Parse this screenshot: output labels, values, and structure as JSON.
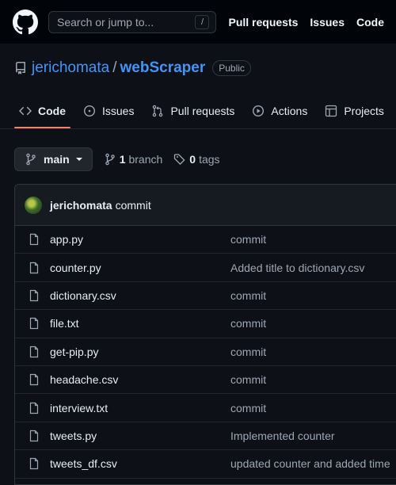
{
  "header": {
    "logo_icon": "github-mark-icon",
    "search_placeholder": "Search or jump to...",
    "search_shortcut": "/",
    "nav": [
      "Pull requests",
      "Issues",
      "Code"
    ]
  },
  "repo": {
    "owner": "jerichomata",
    "separator": "/",
    "name": "webScraper",
    "visibility": "Public"
  },
  "tabs": [
    {
      "label": "Code",
      "icon": "code-icon",
      "active": true
    },
    {
      "label": "Issues",
      "icon": "issue-icon",
      "active": false
    },
    {
      "label": "Pull requests",
      "icon": "pull-request-icon",
      "active": false
    },
    {
      "label": "Actions",
      "icon": "play-icon",
      "active": false
    },
    {
      "label": "Projects",
      "icon": "table-icon",
      "active": false
    }
  ],
  "branch": {
    "current": "main",
    "branch_count": "1",
    "branch_label": "branch",
    "tag_count": "0",
    "tag_label": "tags"
  },
  "latest_commit": {
    "author": "jerichomata",
    "message": "commit"
  },
  "files": [
    {
      "name": "app.py",
      "commit": "commit"
    },
    {
      "name": "counter.py",
      "commit": "Added title to dictionary.csv"
    },
    {
      "name": "dictionary.csv",
      "commit": "commit"
    },
    {
      "name": "file.txt",
      "commit": "commit"
    },
    {
      "name": "get-pip.py",
      "commit": "commit"
    },
    {
      "name": "headache.csv",
      "commit": "commit"
    },
    {
      "name": "interview.txt",
      "commit": "commit"
    },
    {
      "name": "tweets.py",
      "commit": "Implemented counter"
    },
    {
      "name": "tweets_df.csv",
      "commit": "updated counter and added time"
    }
  ],
  "colors": {
    "background": "#0d1117",
    "header_bg": "#010409",
    "link": "#4493f8",
    "active_tab_underline": "#f78166",
    "muted_text": "#9da7b3"
  }
}
